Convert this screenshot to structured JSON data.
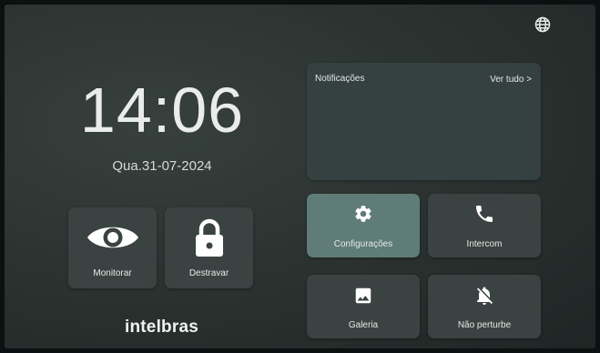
{
  "header": {
    "language_icon": "globe-icon"
  },
  "clock": {
    "time": "14:06",
    "date": "Qua.31-07-2024"
  },
  "notifications": {
    "title": "Notificações",
    "see_all": "Ver tudo >"
  },
  "tiles": {
    "monitor": {
      "label": "Monitorar",
      "icon": "eye-icon"
    },
    "unlock": {
      "label": "Destravar",
      "icon": "lock-icon"
    },
    "settings": {
      "label": "Configurações",
      "icon": "gear-icon"
    },
    "intercom": {
      "label": "Intercom",
      "icon": "phone-icon"
    },
    "gallery": {
      "label": "Galeria",
      "icon": "image-icon"
    },
    "dnd": {
      "label": "Não perturbe",
      "icon": "bell-off-icon"
    }
  },
  "brand": {
    "logo_text": "intelbras"
  },
  "colors": {
    "background": "#2c3432",
    "tile": "#3a4341",
    "tile_selected": "#5f7c78",
    "text": "#e6e9e8"
  }
}
